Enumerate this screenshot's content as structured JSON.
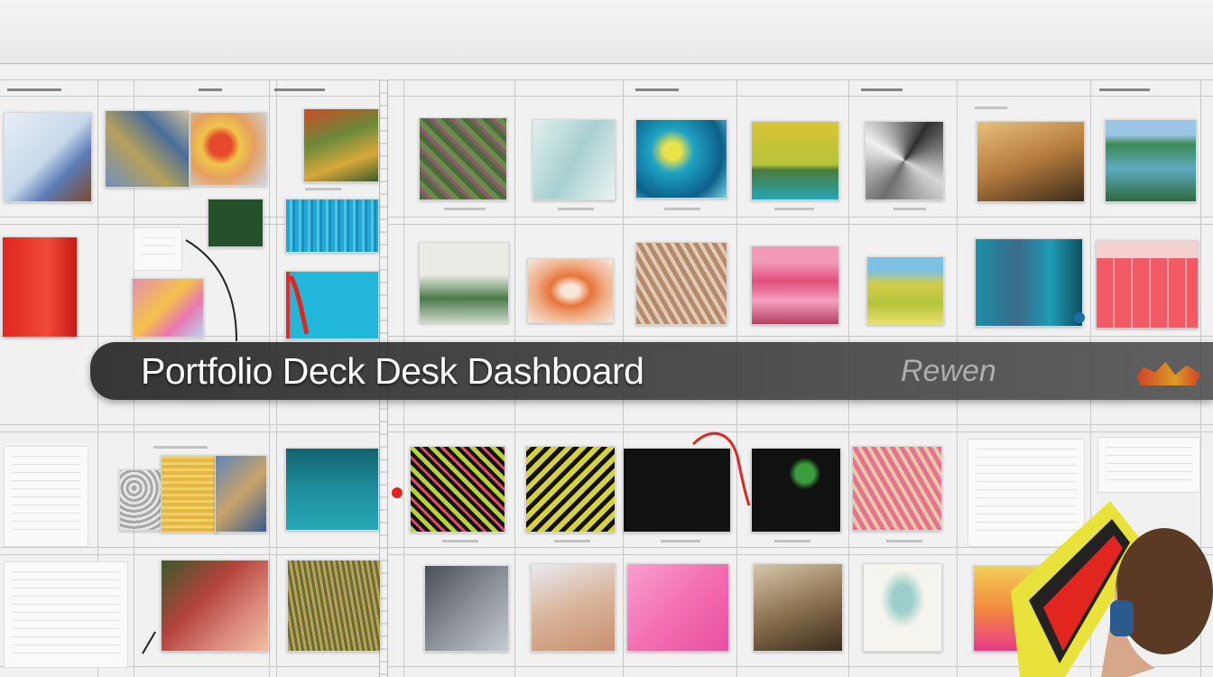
{
  "banner": {
    "title": "Portfolio Deck Desk Dashboard",
    "tail": "Rewen"
  },
  "colors": {
    "board": "#f1f1f1",
    "banner": "#2b2b2b",
    "accent_red": "#e0261f",
    "accent_orange": "#f2a61b"
  },
  "icons": [
    "pen-stroke-icon"
  ],
  "thumbnails": [
    {
      "name": "thumb-sketch-figure",
      "color": "#c7d9ea"
    },
    {
      "name": "thumb-collage-blue",
      "color": "#6f8fc0"
    },
    {
      "name": "thumb-colorful-abstract",
      "color": "#e7a060"
    },
    {
      "name": "thumb-forest-texture",
      "color": "#6b8a3a"
    },
    {
      "name": "thumb-green-knit",
      "color": "#4c6a3c"
    },
    {
      "name": "thumb-glass-shards",
      "color": "#a9cfd0"
    },
    {
      "name": "thumb-teal-splash",
      "color": "#1fa3c4"
    },
    {
      "name": "thumb-yellow-field",
      "color": "#d9c536"
    },
    {
      "name": "thumb-crystal-grey",
      "color": "#6e6e6e"
    },
    {
      "name": "thumb-wooden-room",
      "color": "#b37a3d"
    },
    {
      "name": "thumb-lake-forest",
      "color": "#3d8a55"
    },
    {
      "name": "thumb-dark-green-square",
      "color": "#24502a"
    },
    {
      "name": "thumb-cyan-waves",
      "color": "#23a8d6"
    },
    {
      "name": "thumb-red-block",
      "color": "#e0261f"
    },
    {
      "name": "thumb-pink-marble",
      "color": "#e58fb3"
    },
    {
      "name": "thumb-cyan-pool",
      "color": "#22b6da"
    },
    {
      "name": "thumb-misty-landscape",
      "color": "#6d8f6a"
    },
    {
      "name": "thumb-orange-floral",
      "color": "#e8743a"
    },
    {
      "name": "thumb-tan-lace",
      "color": "#b58a6b"
    },
    {
      "name": "thumb-pink-mountain",
      "color": "#e24e7c"
    },
    {
      "name": "thumb-yellow-garden",
      "color": "#d2cd4a"
    },
    {
      "name": "thumb-teal-cave",
      "color": "#1d8fa6"
    },
    {
      "name": "thumb-pink-grid",
      "color": "#f25a66"
    },
    {
      "name": "thumb-lace-grey",
      "color": "#a6a6a6"
    },
    {
      "name": "thumb-yellow-knit",
      "color": "#e5b844"
    },
    {
      "name": "thumb-blue-feather",
      "color": "#5d86b8"
    },
    {
      "name": "thumb-teal-gradient",
      "color": "#1d8e9c"
    },
    {
      "name": "thumb-neon-pattern",
      "color": "#b9d23b"
    },
    {
      "name": "thumb-neon-yellow",
      "color": "#d8d23a"
    },
    {
      "name": "thumb-black-pattern",
      "color": "#111111"
    },
    {
      "name": "thumb-green-glyph",
      "color": "#3a9c3a"
    },
    {
      "name": "thumb-pink-weave",
      "color": "#e3738e"
    },
    {
      "name": "thumb-red-bird",
      "color": "#b4433b"
    },
    {
      "name": "thumb-golden-grass",
      "color": "#b7a352"
    },
    {
      "name": "thumb-grey-stone",
      "color": "#8a8f96"
    },
    {
      "name": "thumb-skin-grey",
      "color": "#d9b49a"
    },
    {
      "name": "thumb-pink-gradient",
      "color": "#f36fb2"
    },
    {
      "name": "thumb-brown-room",
      "color": "#8d7452"
    },
    {
      "name": "thumb-teal-sketch",
      "color": "#9ccfc9"
    },
    {
      "name": "thumb-sunset-gradient",
      "color": "#f28a3c"
    }
  ]
}
